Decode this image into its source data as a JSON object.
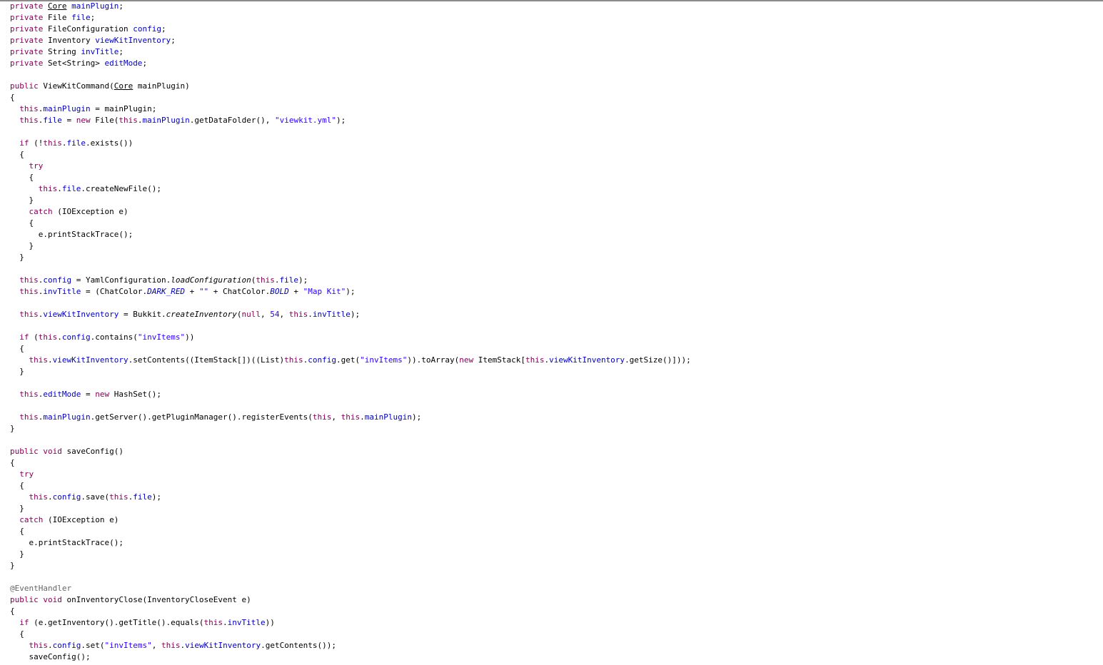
{
  "editor": {
    "lines": [
      [
        {
          "t": "private",
          "c": "kw"
        },
        {
          "t": " "
        },
        {
          "t": "Core",
          "c": "u"
        },
        {
          "t": " "
        },
        {
          "t": "mainPlugin",
          "c": "fld"
        },
        {
          "t": ";"
        }
      ],
      [
        {
          "t": "private",
          "c": "kw"
        },
        {
          "t": " File "
        },
        {
          "t": "file",
          "c": "fld"
        },
        {
          "t": ";"
        }
      ],
      [
        {
          "t": "private",
          "c": "kw"
        },
        {
          "t": " FileConfiguration "
        },
        {
          "t": "config",
          "c": "fld"
        },
        {
          "t": ";"
        }
      ],
      [
        {
          "t": "private",
          "c": "kw"
        },
        {
          "t": " Inventory "
        },
        {
          "t": "viewKitInventory",
          "c": "fld"
        },
        {
          "t": ";"
        }
      ],
      [
        {
          "t": "private",
          "c": "kw"
        },
        {
          "t": " String "
        },
        {
          "t": "invTitle",
          "c": "fld"
        },
        {
          "t": ";"
        }
      ],
      [
        {
          "t": "private",
          "c": "kw"
        },
        {
          "t": " Set<String> "
        },
        {
          "t": "editMode",
          "c": "fld"
        },
        {
          "t": ";"
        }
      ],
      [],
      [
        {
          "t": "public",
          "c": "kw"
        },
        {
          "t": " ViewKitCommand("
        },
        {
          "t": "Core",
          "c": "u"
        },
        {
          "t": " mainPlugin)"
        }
      ],
      [
        {
          "t": "{"
        }
      ],
      [
        {
          "t": "  "
        },
        {
          "t": "this",
          "c": "kw"
        },
        {
          "t": "."
        },
        {
          "t": "mainPlugin",
          "c": "fld"
        },
        {
          "t": " = mainPlugin;"
        }
      ],
      [
        {
          "t": "  "
        },
        {
          "t": "this",
          "c": "kw"
        },
        {
          "t": "."
        },
        {
          "t": "file",
          "c": "fld"
        },
        {
          "t": " = "
        },
        {
          "t": "new",
          "c": "kw"
        },
        {
          "t": " File("
        },
        {
          "t": "this",
          "c": "kw"
        },
        {
          "t": "."
        },
        {
          "t": "mainPlugin",
          "c": "fld"
        },
        {
          "t": ".getDataFolder(), "
        },
        {
          "t": "\"viewkit.yml\"",
          "c": "str"
        },
        {
          "t": ");"
        }
      ],
      [],
      [
        {
          "t": "  "
        },
        {
          "t": "if",
          "c": "kw"
        },
        {
          "t": " (!"
        },
        {
          "t": "this",
          "c": "kw"
        },
        {
          "t": "."
        },
        {
          "t": "file",
          "c": "fld"
        },
        {
          "t": ".exists())"
        }
      ],
      [
        {
          "t": "  {"
        }
      ],
      [
        {
          "t": "    "
        },
        {
          "t": "try",
          "c": "kw"
        }
      ],
      [
        {
          "t": "    {"
        }
      ],
      [
        {
          "t": "      "
        },
        {
          "t": "this",
          "c": "kw"
        },
        {
          "t": "."
        },
        {
          "t": "file",
          "c": "fld"
        },
        {
          "t": ".createNewFile();"
        }
      ],
      [
        {
          "t": "    }"
        }
      ],
      [
        {
          "t": "    "
        },
        {
          "t": "catch",
          "c": "kw"
        },
        {
          "t": " (IOException e)"
        }
      ],
      [
        {
          "t": "    {"
        }
      ],
      [
        {
          "t": "      e.printStackTrace();"
        }
      ],
      [
        {
          "t": "    }"
        }
      ],
      [
        {
          "t": "  }"
        }
      ],
      [],
      [
        {
          "t": "  "
        },
        {
          "t": "this",
          "c": "kw"
        },
        {
          "t": "."
        },
        {
          "t": "config",
          "c": "fld"
        },
        {
          "t": " = YamlConfiguration."
        },
        {
          "t": "loadConfiguration",
          "c": "ital"
        },
        {
          "t": "("
        },
        {
          "t": "this",
          "c": "kw"
        },
        {
          "t": "."
        },
        {
          "t": "file",
          "c": "fld"
        },
        {
          "t": ");"
        }
      ],
      [
        {
          "t": "  "
        },
        {
          "t": "this",
          "c": "kw"
        },
        {
          "t": "."
        },
        {
          "t": "invTitle",
          "c": "fld"
        },
        {
          "t": " = (ChatColor."
        },
        {
          "t": "DARK_RED",
          "c": "itf"
        },
        {
          "t": " + "
        },
        {
          "t": "\"\"",
          "c": "str"
        },
        {
          "t": " + ChatColor."
        },
        {
          "t": "BOLD",
          "c": "itf"
        },
        {
          "t": " + "
        },
        {
          "t": "\"Map Kit\"",
          "c": "str"
        },
        {
          "t": ");"
        }
      ],
      [],
      [
        {
          "t": "  "
        },
        {
          "t": "this",
          "c": "kw"
        },
        {
          "t": "."
        },
        {
          "t": "viewKitInventory",
          "c": "fld"
        },
        {
          "t": " = Bukkit."
        },
        {
          "t": "createInventory",
          "c": "ital"
        },
        {
          "t": "("
        },
        {
          "t": "null",
          "c": "kw"
        },
        {
          "t": ", "
        },
        {
          "t": "54",
          "c": "num"
        },
        {
          "t": ", "
        },
        {
          "t": "this",
          "c": "kw"
        },
        {
          "t": "."
        },
        {
          "t": "invTitle",
          "c": "fld"
        },
        {
          "t": ");"
        }
      ],
      [],
      [
        {
          "t": "  "
        },
        {
          "t": "if",
          "c": "kw"
        },
        {
          "t": " ("
        },
        {
          "t": "this",
          "c": "kw"
        },
        {
          "t": "."
        },
        {
          "t": "config",
          "c": "fld"
        },
        {
          "t": ".contains("
        },
        {
          "t": "\"invItems\"",
          "c": "str"
        },
        {
          "t": "))"
        }
      ],
      [
        {
          "t": "  {"
        }
      ],
      [
        {
          "t": "    "
        },
        {
          "t": "this",
          "c": "kw"
        },
        {
          "t": "."
        },
        {
          "t": "viewKitInventory",
          "c": "fld"
        },
        {
          "t": ".setContents((ItemStack[])((List)"
        },
        {
          "t": "this",
          "c": "kw"
        },
        {
          "t": "."
        },
        {
          "t": "config",
          "c": "fld"
        },
        {
          "t": ".get("
        },
        {
          "t": "\"invItems\"",
          "c": "str"
        },
        {
          "t": ")).toArray("
        },
        {
          "t": "new",
          "c": "kw"
        },
        {
          "t": " ItemStack["
        },
        {
          "t": "this",
          "c": "kw"
        },
        {
          "t": "."
        },
        {
          "t": "viewKitInventory",
          "c": "fld"
        },
        {
          "t": ".getSize()]));"
        }
      ],
      [
        {
          "t": "  }"
        }
      ],
      [],
      [
        {
          "t": "  "
        },
        {
          "t": "this",
          "c": "kw"
        },
        {
          "t": "."
        },
        {
          "t": "editMode",
          "c": "fld"
        },
        {
          "t": " = "
        },
        {
          "t": "new",
          "c": "kw"
        },
        {
          "t": " HashSet();"
        }
      ],
      [],
      [
        {
          "t": "  "
        },
        {
          "t": "this",
          "c": "kw"
        },
        {
          "t": "."
        },
        {
          "t": "mainPlugin",
          "c": "fld"
        },
        {
          "t": ".getServer().getPluginManager().registerEvents("
        },
        {
          "t": "this",
          "c": "kw"
        },
        {
          "t": ", "
        },
        {
          "t": "this",
          "c": "kw"
        },
        {
          "t": "."
        },
        {
          "t": "mainPlugin",
          "c": "fld"
        },
        {
          "t": ");"
        }
      ],
      [
        {
          "t": "}"
        }
      ],
      [],
      [
        {
          "t": "public",
          "c": "kw"
        },
        {
          "t": " "
        },
        {
          "t": "void",
          "c": "kw"
        },
        {
          "t": " saveConfig()"
        }
      ],
      [
        {
          "t": "{"
        }
      ],
      [
        {
          "t": "  "
        },
        {
          "t": "try",
          "c": "kw"
        }
      ],
      [
        {
          "t": "  {"
        }
      ],
      [
        {
          "t": "    "
        },
        {
          "t": "this",
          "c": "kw"
        },
        {
          "t": "."
        },
        {
          "t": "config",
          "c": "fld"
        },
        {
          "t": ".save("
        },
        {
          "t": "this",
          "c": "kw"
        },
        {
          "t": "."
        },
        {
          "t": "file",
          "c": "fld"
        },
        {
          "t": ");"
        }
      ],
      [
        {
          "t": "  }"
        }
      ],
      [
        {
          "t": "  "
        },
        {
          "t": "catch",
          "c": "kw"
        },
        {
          "t": " (IOException e)"
        }
      ],
      [
        {
          "t": "  {"
        }
      ],
      [
        {
          "t": "    e.printStackTrace();"
        }
      ],
      [
        {
          "t": "  }"
        }
      ],
      [
        {
          "t": "}"
        }
      ],
      [],
      [
        {
          "t": "@EventHandler",
          "c": "ann"
        }
      ],
      [
        {
          "t": "public",
          "c": "kw"
        },
        {
          "t": " "
        },
        {
          "t": "void",
          "c": "kw"
        },
        {
          "t": " onInventoryClose(InventoryCloseEvent e)"
        }
      ],
      [
        {
          "t": "{"
        }
      ],
      [
        {
          "t": "  "
        },
        {
          "t": "if",
          "c": "kw"
        },
        {
          "t": " (e.getInventory().getTitle().equals("
        },
        {
          "t": "this",
          "c": "kw"
        },
        {
          "t": "."
        },
        {
          "t": "invTitle",
          "c": "fld"
        },
        {
          "t": "))"
        }
      ],
      [
        {
          "t": "  {"
        }
      ],
      [
        {
          "t": "    "
        },
        {
          "t": "this",
          "c": "kw"
        },
        {
          "t": "."
        },
        {
          "t": "config",
          "c": "fld"
        },
        {
          "t": ".set("
        },
        {
          "t": "\"invItems\"",
          "c": "str"
        },
        {
          "t": ", "
        },
        {
          "t": "this",
          "c": "kw"
        },
        {
          "t": "."
        },
        {
          "t": "viewKitInventory",
          "c": "fld"
        },
        {
          "t": ".getContents());"
        }
      ],
      [
        {
          "t": "    saveConfig();"
        }
      ]
    ]
  }
}
